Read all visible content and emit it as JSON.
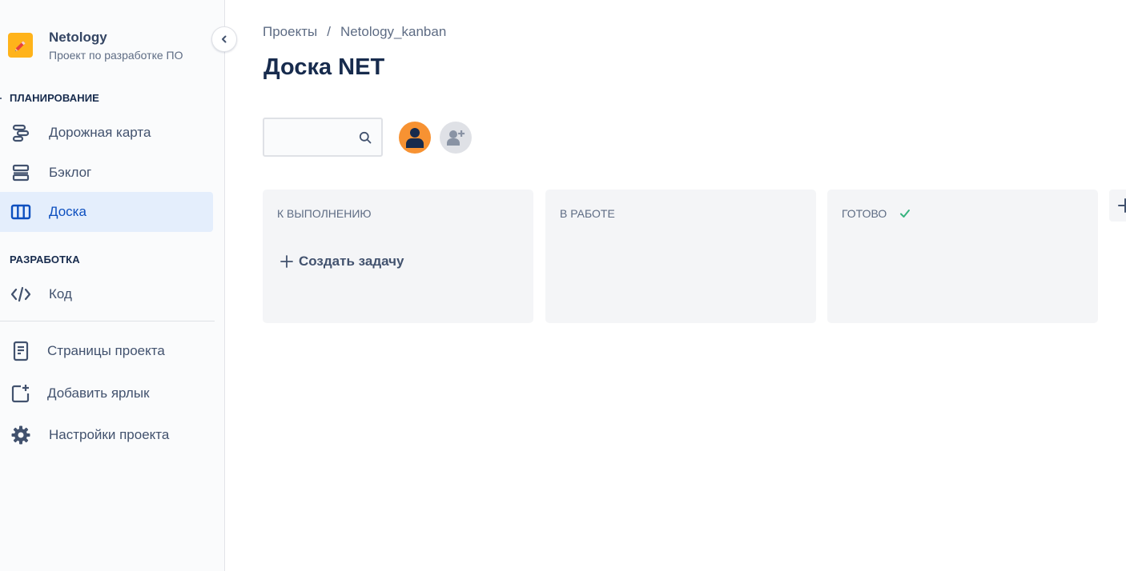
{
  "project": {
    "name": "Netology",
    "subtitle": "Проект по разработке ПО",
    "logo_color": "#ffb31a"
  },
  "sidebar": {
    "sections": [
      {
        "title": "ПЛАНИРОВАНИЕ",
        "items": [
          {
            "label": "Дорожная карта",
            "icon": "roadmap-icon",
            "active": false
          },
          {
            "label": "Бэклог",
            "icon": "backlog-icon",
            "active": false
          },
          {
            "label": "Доска",
            "icon": "board-icon",
            "active": true
          }
        ]
      },
      {
        "title": "РАЗРАБОТКА",
        "items": [
          {
            "label": "Код",
            "icon": "code-icon",
            "active": false
          }
        ]
      }
    ],
    "extra_items": [
      {
        "label": "Страницы проекта",
        "icon": "page-icon"
      },
      {
        "label": "Добавить ярлык",
        "icon": "add-shortcut-icon"
      },
      {
        "label": "Настройки проекта",
        "icon": "gear-icon"
      }
    ]
  },
  "breadcrumb": [
    "Проекты",
    "/",
    "Netology_kanban"
  ],
  "page_title": "Доска NET",
  "search": {
    "value": "",
    "placeholder": ""
  },
  "columns": [
    {
      "title": "К ВЫПОЛНЕНИЮ",
      "create_label": "Создать задачу"
    },
    {
      "title": "В РАБОТЕ"
    },
    {
      "title": "ГОТОВО",
      "done": true
    }
  ],
  "colors": {
    "accent": "#0c4fbf",
    "active_bg": "#e4eefc",
    "column_bg": "#f4f5f7",
    "avatar_user": "#f79232",
    "done_check": "#36b37e"
  }
}
